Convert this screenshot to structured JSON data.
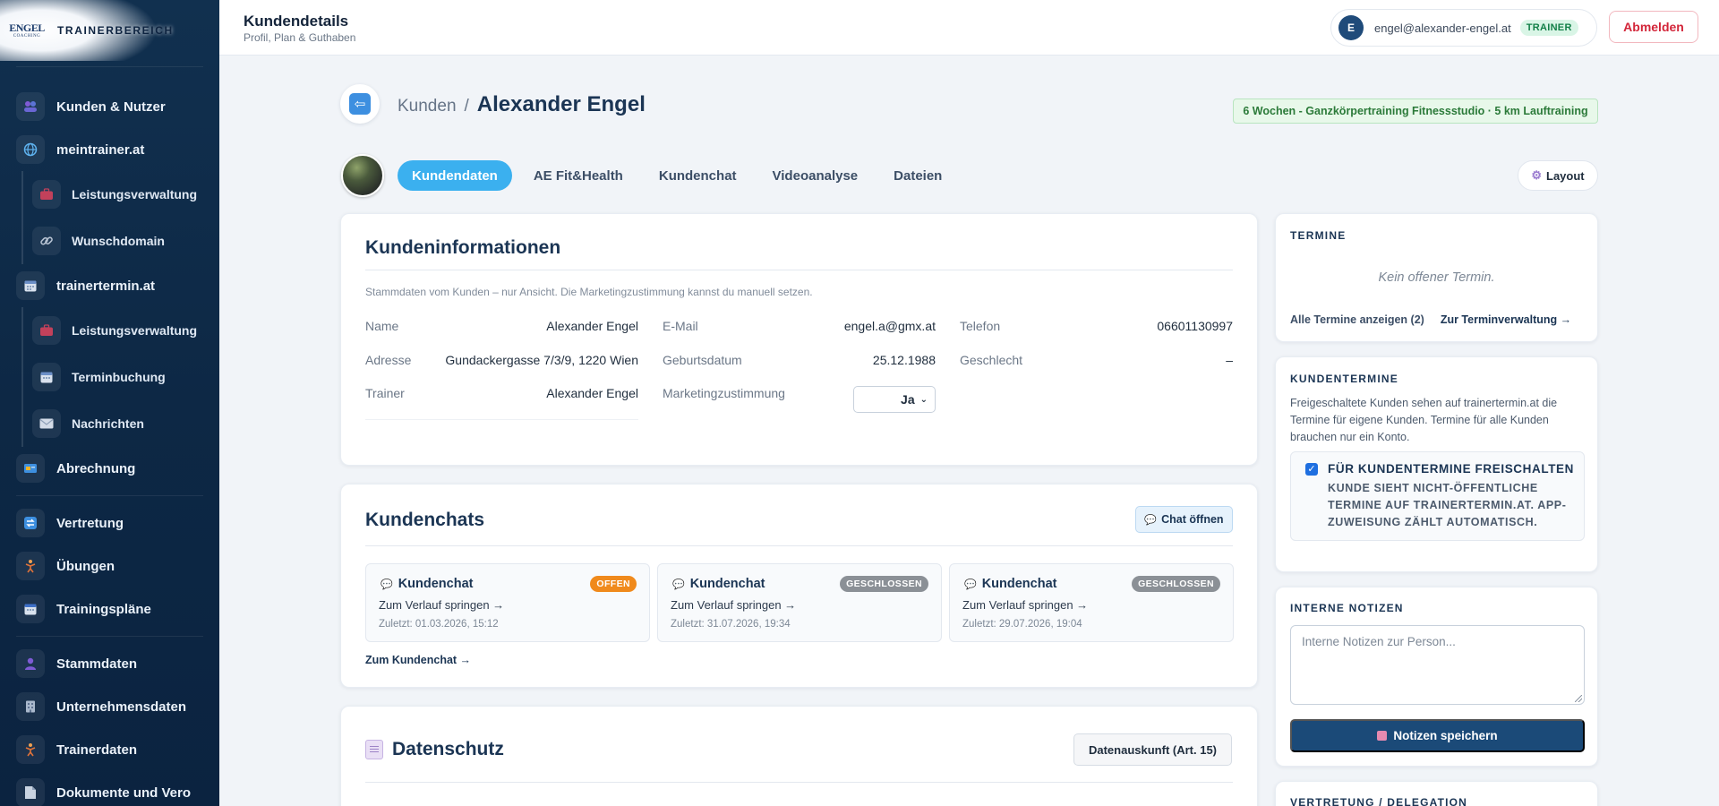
{
  "brand": {
    "logo_top": "ENGEL",
    "logo_bottom": "COACHING",
    "name": "TRAINERBEREICH"
  },
  "sidebar": {
    "items": [
      {
        "label": "Kunden & Nutzer",
        "icon": "users-icon"
      },
      {
        "label": "meintrainer.at",
        "icon": "globe-icon"
      },
      {
        "label": "Leistungsverwaltung",
        "icon": "briefcase-icon"
      },
      {
        "label": "Wunschdomain",
        "icon": "link-icon"
      },
      {
        "label": "trainertermin.at",
        "icon": "calendar-icon"
      },
      {
        "label": "Leistungsverwaltung",
        "icon": "briefcase-icon"
      },
      {
        "label": "Terminbuchung",
        "icon": "calendar-icon"
      },
      {
        "label": "Nachrichten",
        "icon": "mail-icon"
      },
      {
        "label": "Abrechnung",
        "icon": "billing-icon"
      },
      {
        "label": "Vertretung",
        "icon": "swap-icon"
      },
      {
        "label": "Übungen",
        "icon": "dumbbell-icon"
      },
      {
        "label": "Trainingspläne",
        "icon": "calendar-icon"
      },
      {
        "label": "Stammdaten",
        "icon": "person-icon"
      },
      {
        "label": "Unternehmensdaten",
        "icon": "building-icon"
      },
      {
        "label": "Trainerdaten",
        "icon": "dumbbell-icon"
      },
      {
        "label": "Dokumente und Vero",
        "icon": "document-icon"
      }
    ]
  },
  "topbar": {
    "title": "Kundendetails",
    "subtitle": "Profil, Plan & Guthaben",
    "avatar_letter": "E",
    "email": "engel@alexander-engel.at",
    "role": "TRAINER",
    "logout_label": "Abmelden"
  },
  "header": {
    "crumb_parent": "Kunden",
    "crumb_sep": "/",
    "customer_name": "Alexander Engel",
    "plan_badge": "6 Wochen - Ganzkörpertraining Fitnessstudio · 5 km Lauftraining"
  },
  "tabs": [
    {
      "label": "Kundendaten",
      "active": true
    },
    {
      "label": "AE Fit&Health",
      "active": false
    },
    {
      "label": "Kundenchat",
      "active": false
    },
    {
      "label": "Videoanalyse",
      "active": false
    },
    {
      "label": "Dateien",
      "active": false
    }
  ],
  "layout_button": "Layout",
  "info": {
    "title": "Kundeninformationen",
    "hint": "Stammdaten vom Kunden – nur Ansicht. Die Marketingzustimmung kannst du manuell setzen.",
    "fields": {
      "name": {
        "label": "Name",
        "value": "Alexander Engel"
      },
      "email": {
        "label": "E-Mail",
        "value": "engel.a@gmx.at"
      },
      "phone": {
        "label": "Telefon",
        "value": "06601130997"
      },
      "address": {
        "label": "Adresse",
        "value": "Gundackergasse 7/3/9, 1220 Wien"
      },
      "birthdate": {
        "label": "Geburtsdatum",
        "value": "25.12.1988"
      },
      "gender": {
        "label": "Geschlecht",
        "value": "–"
      },
      "trainer": {
        "label": "Trainer",
        "value": "Alexander Engel"
      },
      "marketing": {
        "label": "Marketingzustimmung",
        "value": "Ja"
      }
    }
  },
  "chats": {
    "title": "Kundenchats",
    "open_button": "Chat öffnen",
    "tiles": [
      {
        "title": "Kundenchat",
        "status": "OFFEN",
        "link": "Zum Verlauf springen →",
        "date": "Zuletzt: 01.03.2026, 15:12"
      },
      {
        "title": "Kundenchat",
        "status": "GESCHLOSSEN",
        "link": "Zum Verlauf springen →",
        "date": "Zuletzt: 31.07.2026, 19:34"
      },
      {
        "title": "Kundenchat",
        "status": "GESCHLOSSEN",
        "link": "Zum Verlauf springen →",
        "date": "Zuletzt: 29.07.2026, 19:04"
      }
    ],
    "more_link": "Zum Kundenchat →"
  },
  "privacy": {
    "title": "Datenschutz",
    "button": "Datenauskunft (Art. 15)"
  },
  "termine": {
    "title": "TERMINE",
    "empty": "Kein offener Termin.",
    "all_link": "Alle Termine anzeigen (2)",
    "manage_link": "Zur Terminverwaltung →"
  },
  "kundentermine": {
    "title": "KUNDENTERMINE",
    "desc": "Freigeschaltete Kunden sehen auf trainertermin.at die Termine für eigene Kunden. Termine für alle Kunden brauchen nur ein Konto.",
    "check_label": "FÜR KUNDENTERMINE FREISCHALTEN",
    "check_sub": "KUNDE SIEHT NICHT-ÖFFENTLICHE TERMINE AUF TRAINERTERMIN.AT. APP-ZUWEISUNG ZÄHLT AUTOMATISCH.",
    "checked": true
  },
  "notes": {
    "title": "INTERNE NOTIZEN",
    "placeholder": "Interne Notizen zur Person...",
    "save_label": "Notizen speichern"
  },
  "delegation": {
    "title": "VERTRETUNG / DELEGATION"
  },
  "colors": {
    "sidebar": "#0d2845",
    "accent": "#3bb0ef",
    "primary": "#1b4a78",
    "danger": "#d3263a",
    "open": "#f08a1c",
    "closed": "#8b9096"
  }
}
